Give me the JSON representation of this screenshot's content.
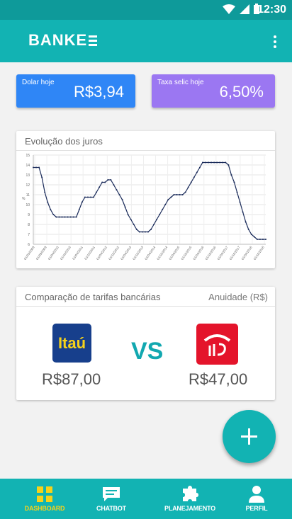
{
  "status_bar": {
    "time": "12:30"
  },
  "app_bar": {
    "logo_text": "BANKE",
    "menu_icon": "more-vert-icon"
  },
  "rate_cards": {
    "dolar": {
      "label": "Dolar hoje",
      "value": "R$3,94",
      "color": "#2f86f6"
    },
    "selic": {
      "label": "Taxa selic hoje",
      "value": "6,50%",
      "color": "#9b77f2"
    }
  },
  "chart_panel": {
    "title": "Evolução dos juros"
  },
  "chart_data": {
    "type": "line",
    "title": "",
    "xlabel": "",
    "ylabel": "%",
    "ylim": [
      6,
      15
    ],
    "y_ticks": [
      "6",
      "7",
      "8",
      "9",
      "10",
      "11",
      "12",
      "13",
      "14",
      "15"
    ],
    "x_ticks": [
      "01/03/2009",
      "01/09/2009",
      "01/04/2010",
      "01/10/2010",
      "01/04/2011",
      "01/10/2011",
      "01/04/2012",
      "01/10/2012",
      "01/04/2013",
      "01/10/2013",
      "01/04/2014",
      "01/10/2014",
      "01/04/2015",
      "01/10/2015",
      "01/04/2016",
      "01/10/2016",
      "01/04/2017",
      "01/10/2017",
      "01/04/2018",
      "01/10/2018"
    ],
    "grid": true,
    "series": [
      {
        "color": "#1a2b5a",
        "values": [
          13.75,
          13.75,
          13.75,
          12.75,
          11.25,
          10.25,
          9.5,
          9.0,
          8.75,
          8.75,
          8.75,
          8.75,
          8.75,
          8.75,
          8.75,
          8.75,
          9.5,
          10.25,
          10.75,
          10.75,
          10.75,
          10.75,
          11.25,
          11.75,
          12.25,
          12.25,
          12.5,
          12.5,
          12.0,
          11.5,
          11.0,
          10.5,
          9.75,
          9.0,
          8.5,
          8.0,
          7.5,
          7.25,
          7.25,
          7.25,
          7.25,
          7.5,
          8.0,
          8.5,
          9.0,
          9.5,
          10.0,
          10.5,
          10.75,
          11.0,
          11.0,
          11.0,
          11.0,
          11.25,
          11.75,
          12.25,
          12.75,
          13.25,
          13.75,
          14.25,
          14.25,
          14.25,
          14.25,
          14.25,
          14.25,
          14.25,
          14.25,
          14.25,
          14.0,
          13.0,
          12.25,
          11.25,
          10.25,
          9.25,
          8.25,
          7.5,
          7.0,
          6.75,
          6.5,
          6.5,
          6.5,
          6.5
        ]
      }
    ]
  },
  "compare_panel": {
    "title": "Comparação de tarifas bancárias",
    "right_label": "Anuidade (R$)",
    "bank_left": {
      "name": "Itaú",
      "price": "R$87,00"
    },
    "vs_text": "VS",
    "bank_right": {
      "price": "R$47,00"
    }
  },
  "bottom_nav": {
    "items": [
      {
        "label": "DASHBOARD",
        "icon": "dashboard-icon",
        "active": true
      },
      {
        "label": "CHATBOT",
        "icon": "chat-icon",
        "active": false
      },
      {
        "label": "PLANEJAMENTO",
        "icon": "puzzle-icon",
        "active": false
      },
      {
        "label": "PERFIL",
        "icon": "person-icon",
        "active": false
      }
    ]
  }
}
